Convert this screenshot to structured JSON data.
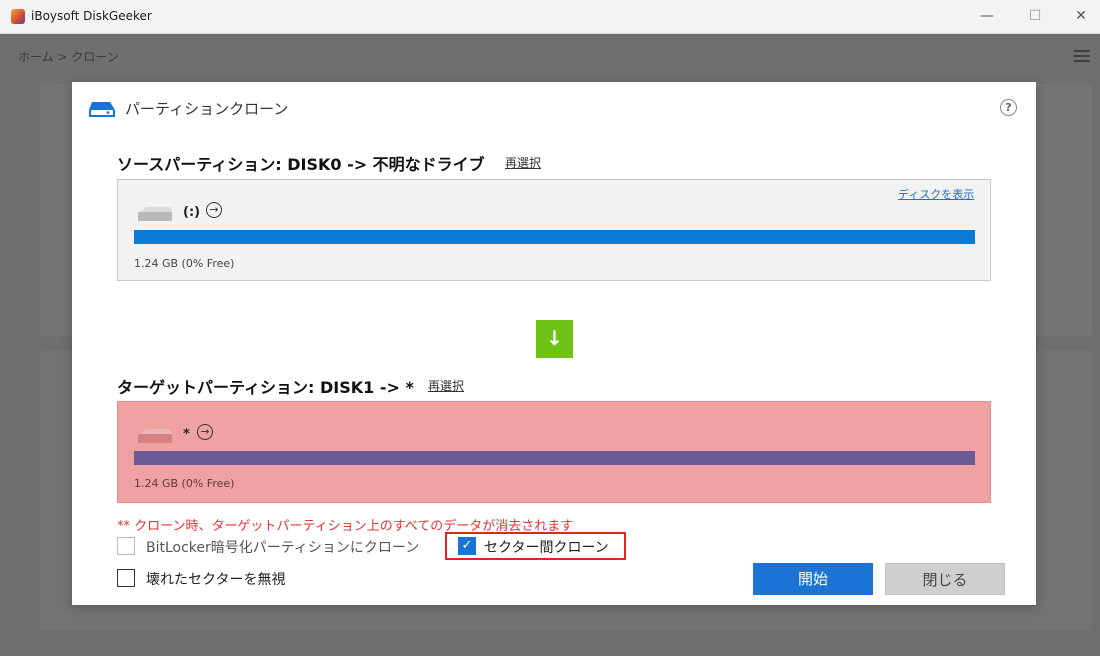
{
  "window": {
    "title": "iBoysoft DiskGeeker"
  },
  "background": {
    "breadcrumb": "ホーム > クローン"
  },
  "dialog": {
    "title": "パーティションクローン",
    "help_symbol": "?",
    "source": {
      "heading": "ソースパーティション: DISK0 -> 不明なドライブ",
      "reselect_label": "再選択",
      "show_disk_label": "ディスクを表示",
      "partition_name": "(:)",
      "size_text": "1.24 GB (0% Free)",
      "used_fraction": 1.0,
      "bar_color": "#0a7ad6"
    },
    "arrow_symbol": "↓",
    "target": {
      "heading": "ターゲットパーティション: DISK1 -> *",
      "reselect_label": "再選択",
      "partition_name": "*",
      "size_text": "1.24 GB (0% Free)",
      "used_fraction": 1.0,
      "bar_color": "#6a5a95"
    },
    "warning": "** クローン時、ターゲットパーティション上のすべてのデータが消去されます",
    "options": {
      "bitlocker": {
        "label": "BitLocker暗号化パーティションにクローン",
        "checked": false,
        "enabled": false
      },
      "sector_by_sector": {
        "label": "セクター間クローン",
        "checked": true,
        "enabled": true
      },
      "ignore_bad_sectors": {
        "label": "壊れたセクターを無視",
        "checked": false,
        "enabled": true
      }
    },
    "buttons": {
      "start": "開始",
      "close": "閉じる"
    }
  },
  "colors": {
    "accent": "#1a74d6",
    "target_highlight": "#f0a1a1",
    "warning": "#e3342f",
    "arrow_button": "#6fc216"
  }
}
